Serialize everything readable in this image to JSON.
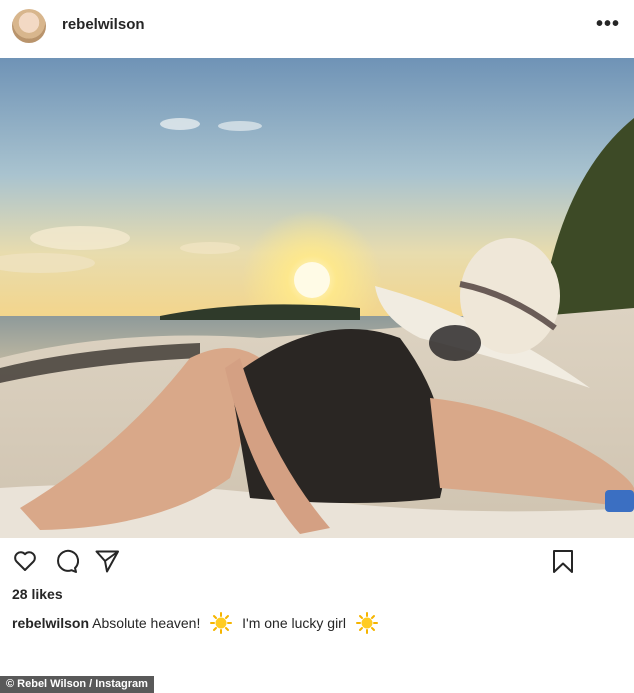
{
  "post": {
    "username": "rebelwilson",
    "more_icon": "more-icon",
    "image_alt": "",
    "actions": {
      "like_icon": "heart-icon",
      "comment_icon": "comment-icon",
      "share_icon": "share-icon",
      "save_icon": "bookmark-icon"
    },
    "likes": "28 likes",
    "caption": {
      "username": "rebelwilson",
      "text_1": "Absolute heaven!",
      "emoji_1": "sun-emoji",
      "text_2": "I'm one lucky girl",
      "emoji_2": "sun-emoji"
    }
  },
  "credit": "© Rebel Wilson / Instagram",
  "colors": {
    "text": "#262626",
    "credit_bg": "#595959"
  }
}
